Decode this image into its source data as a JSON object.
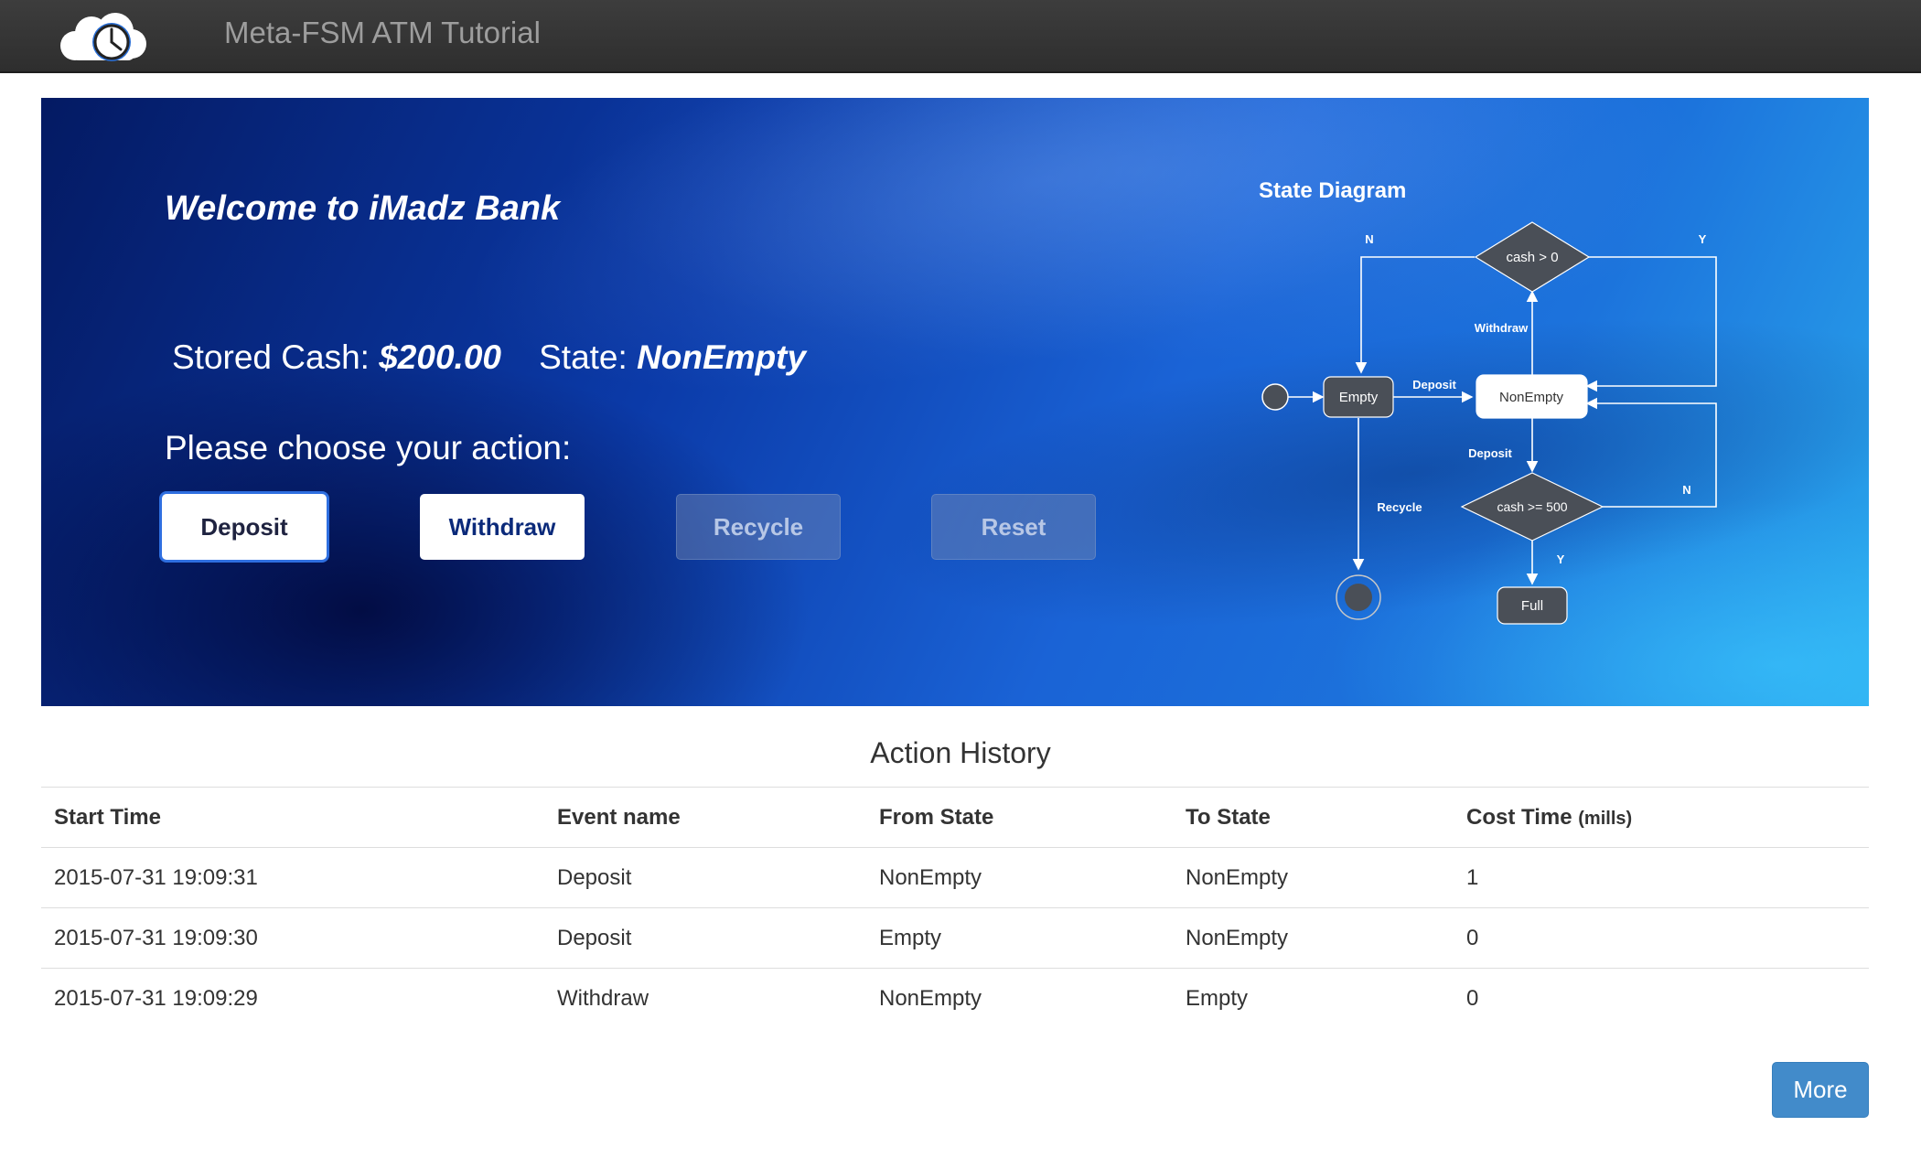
{
  "navbar": {
    "logo_icon": "cloud-clock-icon",
    "title": "Meta-FSM ATM Tutorial"
  },
  "banner": {
    "welcome": "Welcome to iMadz Bank",
    "stored_cash_label": "Stored Cash:",
    "stored_cash_value": "$200.00",
    "state_label": "State:",
    "state_value": "NonEmpty",
    "prompt": "Please choose your action:",
    "buttons": {
      "deposit": "Deposit",
      "withdraw": "Withdraw",
      "recycle": "Recycle",
      "reset": "Reset"
    }
  },
  "state_diagram": {
    "title": "State Diagram",
    "nodes": {
      "cond_cash_gt_0": "cash > 0",
      "empty": "Empty",
      "nonempty": "NonEmpty",
      "cond_cash_ge_500": "cash >= 500",
      "full": "Full"
    },
    "edge_labels": {
      "n_top": "N",
      "y_top": "Y",
      "withdraw": "Withdraw",
      "deposit_top": "Deposit",
      "deposit_mid": "Deposit",
      "recycle": "Recycle",
      "n_right": "N",
      "y_bottom": "Y"
    },
    "highlighted_state": "NonEmpty"
  },
  "history": {
    "title": "Action History",
    "columns": {
      "start_time": "Start Time",
      "event_name": "Event name",
      "from_state": "From State",
      "to_state": "To State",
      "cost_time": "Cost Time",
      "cost_time_unit": "(mills)"
    },
    "rows": [
      {
        "start_time": "2015-07-31 19:09:31",
        "event_name": "Deposit",
        "from_state": "NonEmpty",
        "to_state": "NonEmpty",
        "cost_time": "1"
      },
      {
        "start_time": "2015-07-31 19:09:30",
        "event_name": "Deposit",
        "from_state": "Empty",
        "to_state": "NonEmpty",
        "cost_time": "0"
      },
      {
        "start_time": "2015-07-31 19:09:29",
        "event_name": "Withdraw",
        "from_state": "NonEmpty",
        "to_state": "Empty",
        "cost_time": "0"
      }
    ],
    "more_label": "More"
  },
  "colors": {
    "navbar_bg": "#333333",
    "primary_button": "#428bca",
    "banner_blue": "#0b3aa8"
  }
}
